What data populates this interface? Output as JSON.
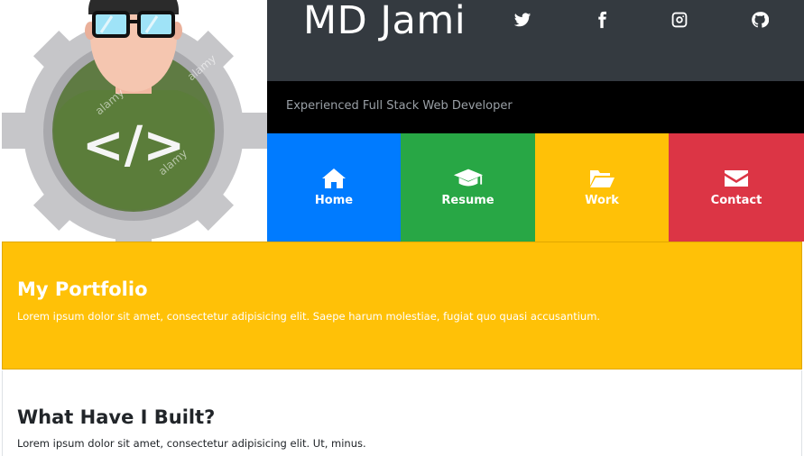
{
  "header": {
    "site_name": "MD Jami",
    "tagline": "Experienced Full Stack Web Developer",
    "social": [
      "twitter-icon",
      "facebook-icon",
      "instagram-icon",
      "github-icon"
    ]
  },
  "nav": {
    "items": [
      {
        "label": "Home",
        "icon": "home-icon",
        "color": "#007bff"
      },
      {
        "label": "Resume",
        "icon": "graduation-cap-icon",
        "color": "#28a745"
      },
      {
        "label": "Work",
        "icon": "folder-open-icon",
        "color": "#ffc107"
      },
      {
        "label": "Contact",
        "icon": "envelope-icon",
        "color": "#dc3545"
      }
    ]
  },
  "avatar": {
    "icon": "developer-avatar-icon",
    "code_glyph": "</>",
    "watermark": "alamy"
  },
  "portfolio": {
    "title": "My Portfolio",
    "text": "Lorem ipsum dolor sit amet, consectetur adipisicing elit. Saepe harum molestiae, fugiat quo quasi accusantium."
  },
  "built": {
    "title": "What Have I Built?",
    "text": "Lorem ipsum dolor sit amet, consectetur adipisicing elit. Ut, minus."
  },
  "colors": {
    "header_bg": "#343a40",
    "tagline_bg": "#000000",
    "banner_bg": "#ffc107"
  }
}
